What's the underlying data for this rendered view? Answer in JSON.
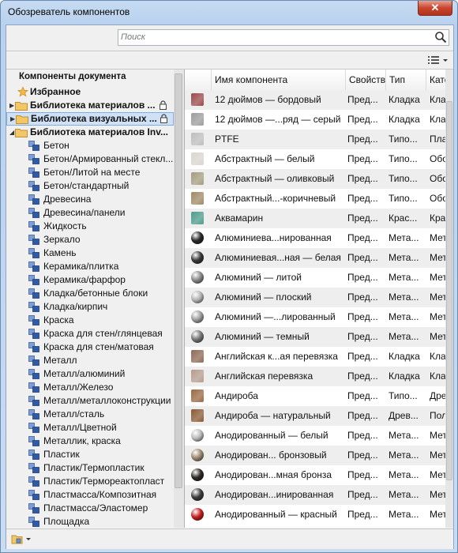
{
  "window": {
    "title": "Обозреватель компонентов",
    "close_glyph": "✕"
  },
  "search": {
    "placeholder": "Поиск",
    "value": ""
  },
  "tree": {
    "header": "Компоненты документа",
    "nodes": [
      {
        "label": "Избранное",
        "kind": "favorite"
      },
      {
        "label": "Библиотека материалов ...",
        "kind": "library",
        "expanded": false,
        "locked": true
      },
      {
        "label": "Библиотека визуальных ...",
        "kind": "library",
        "expanded": false,
        "locked": true,
        "selected": true
      },
      {
        "label": "Библиотека материалов Inv...",
        "kind": "library",
        "expanded": true,
        "locked": false
      }
    ],
    "items": [
      "Бетон",
      "Бетон/Армированный стекл...",
      "Бетон/Литой на месте",
      "Бетон/стандартный",
      "Древесина",
      "Древесина/панели",
      "Жидкость",
      "Зеркало",
      "Камень",
      "Керамика/плитка",
      "Керамика/фарфор",
      "Кладка/бетонные блоки",
      "Кладка/кирпич",
      "Краска",
      "Краска для стен/глянцевая",
      "Краска для стен/матовая",
      "Металл",
      "Металл/алюминий",
      "Металл/Железо",
      "Металл/металлоконструкции",
      "Металл/сталь",
      "Металл/Цветной",
      "Металлик, краска",
      "Пластик",
      "Пластик/Термопластик",
      "Пластик/Термореактопласт",
      "Пластмасса/Композитная",
      "Пластмасса/Эластомер",
      "Площадка"
    ]
  },
  "table": {
    "columns": [
      "Имя компонента",
      "Свойств",
      "Тип",
      "Кате"
    ],
    "rows": [
      {
        "name": "12 дюймов — бордовый",
        "prop": "Пред...",
        "type": "Кладка",
        "cat": "Кла",
        "swatch": "#9a4a4a",
        "shape": "square"
      },
      {
        "name": "12 дюймов —...ряд — серый",
        "prop": "Пред...",
        "type": "Кладка",
        "cat": "Кла",
        "swatch": "#9c9c9c",
        "shape": "square"
      },
      {
        "name": "PTFE",
        "prop": "Пред...",
        "type": "Типо...",
        "cat": "Пла",
        "swatch": "#bdbdbd",
        "shape": "square"
      },
      {
        "name": "Абстрактный — белый",
        "prop": "Пред...",
        "type": "Типо...",
        "cat": "Обо",
        "swatch": "#d9d5cf",
        "shape": "square"
      },
      {
        "name": "Абстрактный — оливковый",
        "prop": "Пред...",
        "type": "Типо...",
        "cat": "Обо",
        "swatch": "#a59c7e",
        "shape": "square"
      },
      {
        "name": "Абстрактный...-коричневый",
        "prop": "Пред...",
        "type": "Типо...",
        "cat": "Обо",
        "swatch": "#a08a66",
        "shape": "square"
      },
      {
        "name": "Аквамарин",
        "prop": "Пред...",
        "type": "Крас...",
        "cat": "Кра",
        "swatch": "#4e9b8c",
        "shape": "square"
      },
      {
        "name": "Алюминиева...нированная",
        "prop": "Пред...",
        "type": "Мета...",
        "cat": "Мет",
        "swatch": "#2a2a2a",
        "shape": "ball"
      },
      {
        "name": "Алюминиевая...ная — белая",
        "prop": "Пред...",
        "type": "Мета...",
        "cat": "Мет",
        "swatch": "#3a3a3a",
        "shape": "ball"
      },
      {
        "name": "Алюминий — литой",
        "prop": "Пред...",
        "type": "Мета...",
        "cat": "Мет",
        "swatch": "#8a8a8a",
        "shape": "ball"
      },
      {
        "name": "Алюминий — плоский",
        "prop": "Пред...",
        "type": "Мета...",
        "cat": "Мет",
        "swatch": "#b5b5b5",
        "shape": "ball"
      },
      {
        "name": "Алюминий —...лированный",
        "prop": "Пред...",
        "type": "Мета...",
        "cat": "Мет",
        "swatch": "#9e9e9e",
        "shape": "ball"
      },
      {
        "name": "Алюминий — темный",
        "prop": "Пред...",
        "type": "Мета...",
        "cat": "Мет",
        "swatch": "#777777",
        "shape": "ball"
      },
      {
        "name": "Английская к...ая перевязка",
        "prop": "Пред...",
        "type": "Кладка",
        "cat": "Кла",
        "swatch": "#8e6a58",
        "shape": "square"
      },
      {
        "name": "Английская перевязка",
        "prop": "Пред...",
        "type": "Кладка",
        "cat": "Кла",
        "swatch": "#b49c8e",
        "shape": "square"
      },
      {
        "name": "Андироба",
        "prop": "Пред...",
        "type": "Типо...",
        "cat": "Дре",
        "swatch": "#9a6b44",
        "shape": "square"
      },
      {
        "name": "Андироба — натуральный",
        "prop": "Пред...",
        "type": "Древ...",
        "cat": "Пол",
        "swatch": "#8a5a36",
        "shape": "square"
      },
      {
        "name": "Анодированный — белый",
        "prop": "Пред...",
        "type": "Мета...",
        "cat": "Мет",
        "swatch": "#bcbcbc",
        "shape": "ball"
      },
      {
        "name": "Анодирован... бронзовый",
        "prop": "Пред...",
        "type": "Мета...",
        "cat": "Мет",
        "swatch": "#9c8a70",
        "shape": "ball"
      },
      {
        "name": "Анодирован...мная бронза",
        "prop": "Пред...",
        "type": "Мета...",
        "cat": "Мет",
        "swatch": "#2e2a26",
        "shape": "ball"
      },
      {
        "name": "Анодирован...инированная",
        "prop": "Пред...",
        "type": "Мета...",
        "cat": "Мет",
        "swatch": "#3c3c3c",
        "shape": "ball"
      },
      {
        "name": "Анодированный — красный",
        "prop": "Пред...",
        "type": "Мета...",
        "cat": "Мет",
        "swatch": "#c21f1f",
        "shape": "ball"
      }
    ]
  },
  "icons": {
    "search": "magnifier-icon",
    "view": "list-view-icon",
    "folder": "folder-icon",
    "lock": "lock-icon",
    "favorite": "star-icon",
    "material": "material-library-icon",
    "bottom": "library-manage-icon"
  }
}
